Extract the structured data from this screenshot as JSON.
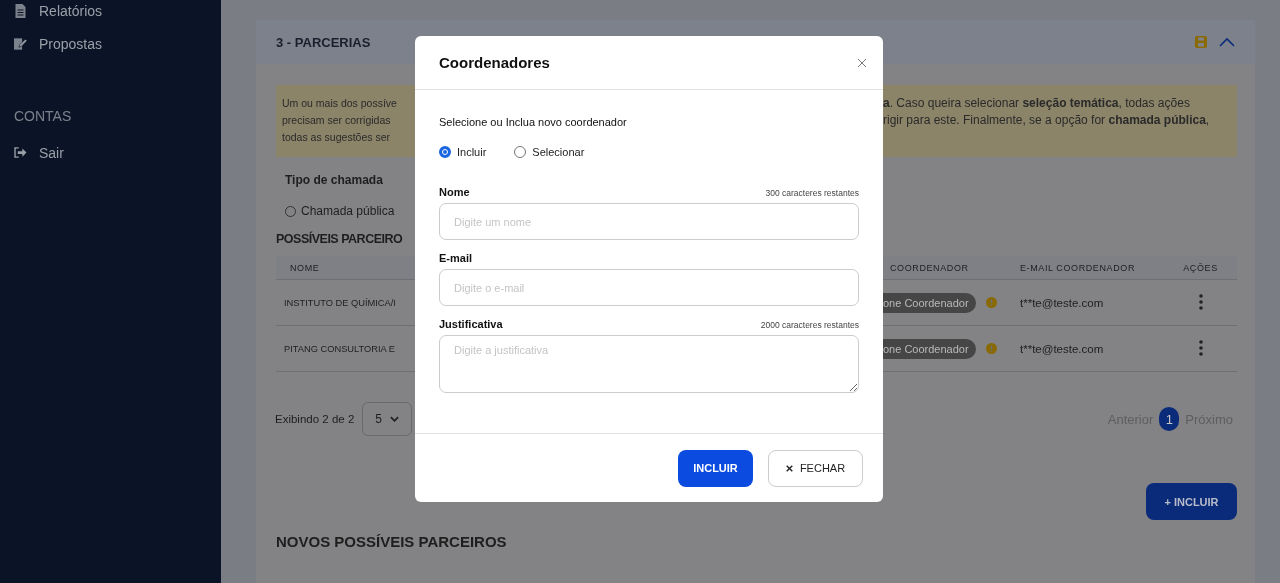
{
  "sidebar": {
    "items": [
      {
        "label": "Relatórios"
      },
      {
        "label": "Propostas"
      }
    ],
    "section_label": "CONTAS",
    "account_items": [
      {
        "label": "Sair"
      }
    ]
  },
  "section": {
    "title": "3 - PARCERIAS",
    "expanded": true
  },
  "notice": {
    "left_lines": [
      "Um ou mais dos possíve",
      "precisam ser corrigidas",
      "todas as sugestões ser"
    ],
    "right_lines": [
      "**a**. Caso queira selecionar **seleção temática**, todas ações",
      "rigir para este. Finalmente, se a opção for **chamada pública**,"
    ]
  },
  "call_type": {
    "label": "Tipo de chamada",
    "options": [
      {
        "label": "Chamada pública",
        "selected": false
      }
    ]
  },
  "partners": {
    "title": "POSSÍVEIS PARCEIRO",
    "columns_left": [
      "NOME"
    ],
    "columns_right": [
      "COORDENADOR",
      "E-MAIL COORDENADOR",
      "AÇÕES"
    ],
    "rows": [
      {
        "name": "INSTITUTO DE QUÍMICA/I",
        "coordinator": "one Coordenador",
        "email": "t**te@teste.com"
      },
      {
        "name": "PITANG CONSULTORIA E",
        "coordinator": "one Coordenador",
        "email": "t**te@teste.com"
      }
    ]
  },
  "pagination": {
    "showing": "Exibindo 2 de 2",
    "page_size": "5",
    "previous": "Anterior",
    "pages": [
      {
        "label": "1",
        "selected": true
      }
    ],
    "next": "Próximo"
  },
  "add_button": "+ INCLUIR",
  "new_partners_title": "NOVOS POSSÍVEIS PARCEIROS",
  "modal": {
    "title": "Coordenadores",
    "prompt": "Selecione ou Inclua novo coordenador",
    "modes": [
      {
        "label": "Incluir",
        "selected": true
      },
      {
        "label": "Selecionar",
        "selected": false
      }
    ],
    "fields": [
      {
        "kind": "input",
        "label": "Nome",
        "counter": "300 caracteres restantes",
        "placeholder": "Digite um nome"
      },
      {
        "kind": "input",
        "label": "E-mail",
        "placeholder": "Digite o e-mail"
      },
      {
        "kind": "textarea",
        "label": "Justificativa",
        "counter": "2000 caracteres restantes",
        "placeholder": "Digite a justificativa"
      }
    ],
    "buttons": [
      {
        "kind": "primary",
        "label": "INCLUIR"
      },
      {
        "kind": "secondary",
        "label": "FECHAR"
      }
    ]
  }
}
